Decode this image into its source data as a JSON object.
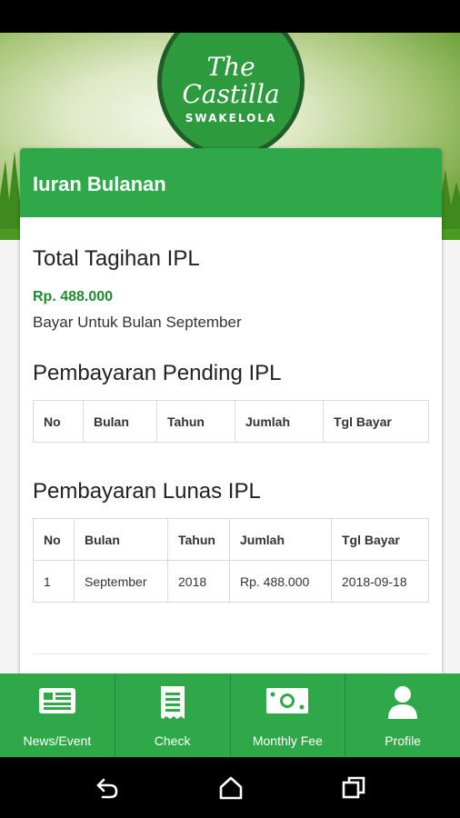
{
  "logo": {
    "line1": "The",
    "line2": "Castilla",
    "line3": "SWAKELOLA"
  },
  "card": {
    "header": "Iuran Bulanan",
    "total_title": "Total Tagihan IPL",
    "amount": "Rp. 488.000",
    "note": "Bayar Untuk Bulan September",
    "pending_title": "Pembayaran Pending IPL",
    "pending_headers": [
      "No",
      "Bulan",
      "Tahun",
      "Jumlah",
      "Tgl Bayar"
    ],
    "lunas_title": "Pembayaran Lunas IPL",
    "lunas_headers": [
      "No",
      "Bulan",
      "Tahun",
      "Jumlah",
      "Tgl Bayar"
    ],
    "lunas_rows": [
      [
        "1",
        "September",
        "2018",
        "Rp. 488.000",
        "2018-09-18"
      ]
    ]
  },
  "bottom_nav": {
    "items": [
      {
        "label": "News/Event",
        "icon": "newspaper-icon"
      },
      {
        "label": "Check",
        "icon": "receipt-icon"
      },
      {
        "label": "Monthly Fee",
        "icon": "money-icon"
      },
      {
        "label": "Profile",
        "icon": "person-icon"
      }
    ]
  },
  "system_nav": {
    "back": "back-icon",
    "home": "home-icon",
    "recents": "recents-icon"
  },
  "colors": {
    "primary": "#2fa84a",
    "amount": "#1e8c2e"
  }
}
